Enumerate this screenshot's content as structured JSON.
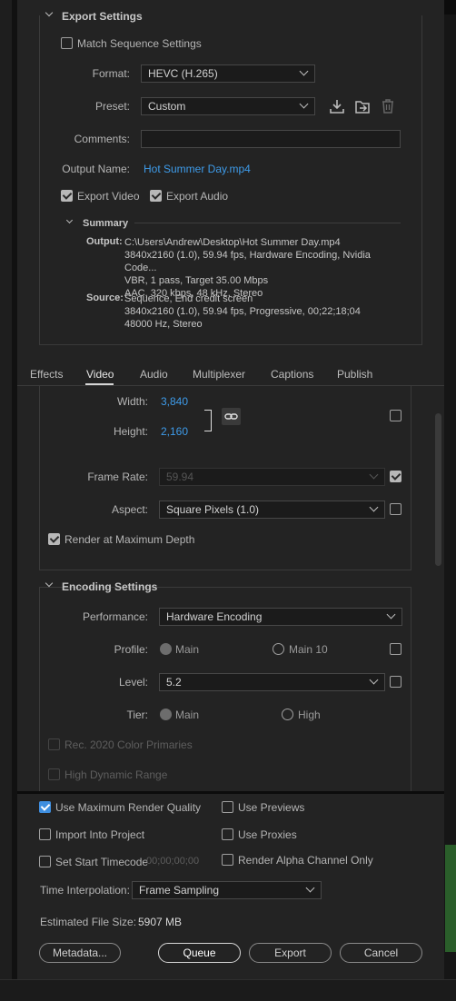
{
  "export_settings": {
    "title": "Export Settings",
    "match_sequence": {
      "label": "Match Sequence Settings",
      "checked": false
    },
    "format": {
      "label": "Format:",
      "value": "HEVC (H.265)"
    },
    "preset": {
      "label": "Preset:",
      "value": "Custom"
    },
    "comments": {
      "label": "Comments:",
      "value": ""
    },
    "output_name": {
      "label": "Output Name:",
      "value": "Hot Summer Day.mp4"
    },
    "export_video": {
      "label": "Export Video",
      "checked": true
    },
    "export_audio": {
      "label": "Export Audio",
      "checked": true
    },
    "summary": {
      "title": "Summary",
      "output_label": "Output:",
      "output_lines": [
        "C:\\Users\\Andrew\\Desktop\\Hot Summer Day.mp4",
        "3840x2160 (1.0), 59.94 fps, Hardware Encoding, Nvidia Code...",
        "VBR, 1 pass, Target 35.00 Mbps",
        "AAC, 320 kbps, 48 kHz, Stereo"
      ],
      "source_label": "Source:",
      "source_lines": [
        "Sequence, End credit screen",
        "3840x2160 (1.0), 59.94 fps, Progressive, 00;22;18;04",
        "48000 Hz, Stereo"
      ]
    }
  },
  "tabs": [
    {
      "label": "Effects",
      "active": false
    },
    {
      "label": "Video",
      "active": true
    },
    {
      "label": "Audio",
      "active": false
    },
    {
      "label": "Multiplexer",
      "active": false
    },
    {
      "label": "Captions",
      "active": false
    },
    {
      "label": "Publish",
      "active": false
    }
  ],
  "video": {
    "width": {
      "label": "Width:",
      "value": "3,840"
    },
    "height": {
      "label": "Height:",
      "value": "2,160"
    },
    "frame_rate": {
      "label": "Frame Rate:",
      "value": "59.94"
    },
    "aspect": {
      "label": "Aspect:",
      "value": "Square Pixels (1.0)"
    },
    "render_max_depth": {
      "label": "Render at Maximum Depth",
      "checked": true
    }
  },
  "encoding": {
    "title": "Encoding Settings",
    "performance": {
      "label": "Performance:",
      "value": "Hardware Encoding"
    },
    "profile": {
      "label": "Profile:",
      "options": [
        "Main",
        "Main 10"
      ]
    },
    "level": {
      "label": "Level:",
      "value": "5.2"
    },
    "tier": {
      "label": "Tier:",
      "options": [
        "Main",
        "High"
      ]
    },
    "rec2020": "Rec. 2020 Color Primaries",
    "hdr": "High Dynamic Range"
  },
  "bottom": {
    "use_max_render_quality": {
      "label": "Use Maximum Render Quality",
      "checked": true
    },
    "use_previews": {
      "label": "Use Previews",
      "checked": false
    },
    "import_into_project": {
      "label": "Import Into Project",
      "checked": false
    },
    "use_proxies": {
      "label": "Use Proxies",
      "checked": false
    },
    "set_start_timecode": {
      "label": "Set Start Timecode",
      "value": "00;00;00;00",
      "checked": false
    },
    "render_alpha": {
      "label": "Render Alpha Channel Only",
      "checked": false
    },
    "time_interpolation": {
      "label": "Time Interpolation:",
      "value": "Frame Sampling"
    },
    "estimated_size": {
      "label": "Estimated File Size:",
      "value": "5907 MB"
    },
    "buttons": {
      "metadata": "Metadata...",
      "queue": "Queue",
      "export": "Export",
      "cancel": "Cancel"
    }
  },
  "colors": {
    "accent": "#3e9be9",
    "panel": "#232323",
    "background": "#1a1a1a"
  }
}
